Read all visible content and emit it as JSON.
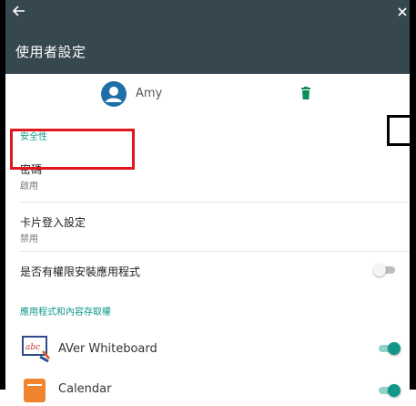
{
  "appbar": {
    "title": "使用者設定",
    "back_icon": "arrow-back-icon",
    "close_icon": "close-icon",
    "bg_color": "#37474f"
  },
  "user": {
    "name": "Amy",
    "avatar_icon": "account-circle-icon",
    "delete_icon": "trash-icon"
  },
  "sections": {
    "security_header": "安全性",
    "apps_header": "應用程式和內容存取權"
  },
  "rows": {
    "password": {
      "title": "密碼",
      "subtitle": "啟用"
    },
    "card_login": {
      "title": "卡片登入設定",
      "subtitle": "禁用"
    },
    "install_permission": {
      "title": "是否有權限安裝應用程式",
      "enabled": false
    }
  },
  "apps": [
    {
      "name": "AVer Whiteboard",
      "icon": "aver-whiteboard-icon",
      "enabled": true
    },
    {
      "name": "Calendar",
      "icon": "calendar-icon",
      "enabled": true
    }
  ],
  "colors": {
    "accent": "#11988b",
    "highlight": "#e2161d"
  }
}
